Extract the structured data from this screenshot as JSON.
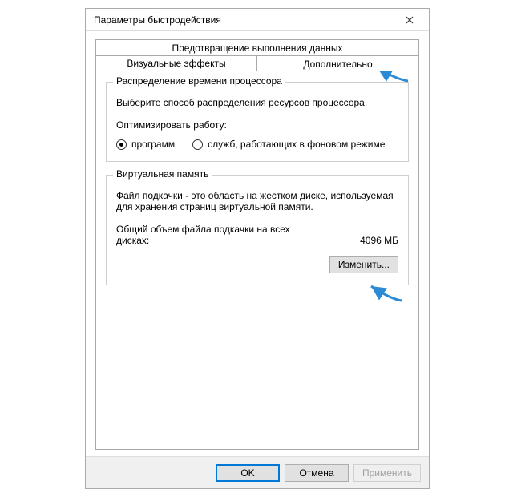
{
  "window": {
    "title": "Параметры быстродействия"
  },
  "tabs": {
    "dep": "Предотвращение выполнения данных",
    "visual": "Визуальные эффекты",
    "advanced": "Дополнительно"
  },
  "cpu": {
    "group_title": "Распределение времени процессора",
    "description": "Выберите способ распределения ресурсов процессора.",
    "optimize_label": "Оптимизировать работу:",
    "option_programs": "программ",
    "option_services": "служб, работающих в фоновом режиме"
  },
  "vm": {
    "group_title": "Виртуальная память",
    "description": "Файл подкачки - это область на жестком диске, используемая для хранения страниц виртуальной памяти.",
    "total_label": "Общий объем файла подкачки на всех дисках:",
    "total_value": "4096 МБ",
    "change_button": "Изменить..."
  },
  "footer": {
    "ok": "OK",
    "cancel": "Отмена",
    "apply": "Применить"
  }
}
